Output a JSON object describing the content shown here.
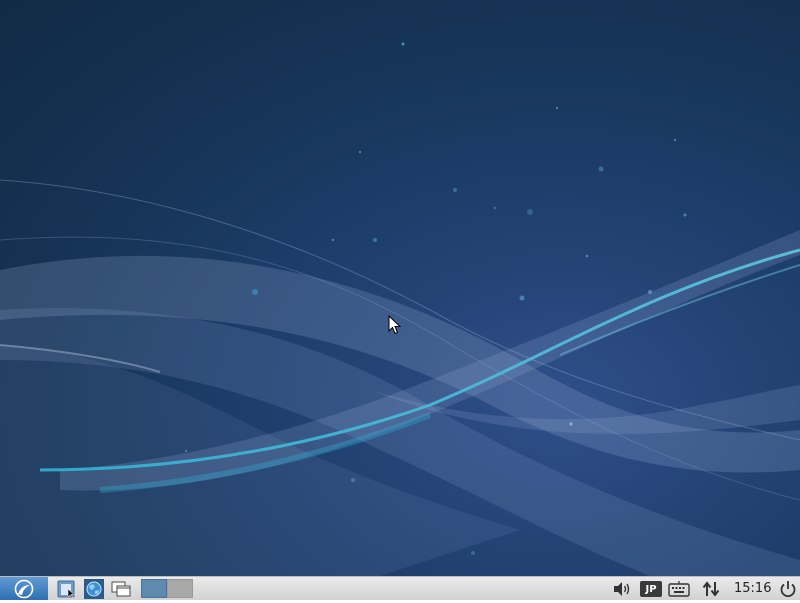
{
  "desktop": {
    "wallpaper": "lubuntu-wave-wallpaper",
    "colors": {
      "background_dark": "#112a45",
      "background_mid": "#1f3f6e",
      "wave_cyan": "#2fb3d6",
      "wave_light": "#8fa8d0"
    }
  },
  "taskbar": {
    "start_menu_icon": "lubuntu-logo-icon",
    "launchers": [
      {
        "icon": "file-manager-icon"
      },
      {
        "icon": "web-browser-icon"
      },
      {
        "icon": "show-desktop-icon"
      }
    ],
    "workspaces": [
      {
        "active": true
      },
      {
        "active": false
      }
    ],
    "tray": {
      "volume_icon": "speaker-icon",
      "keyboard_layout": "JP",
      "keyboard_icon": "keyboard-icon",
      "network_icon": "network-arrows-icon",
      "clock": "15:16",
      "power_icon": "power-icon"
    }
  }
}
